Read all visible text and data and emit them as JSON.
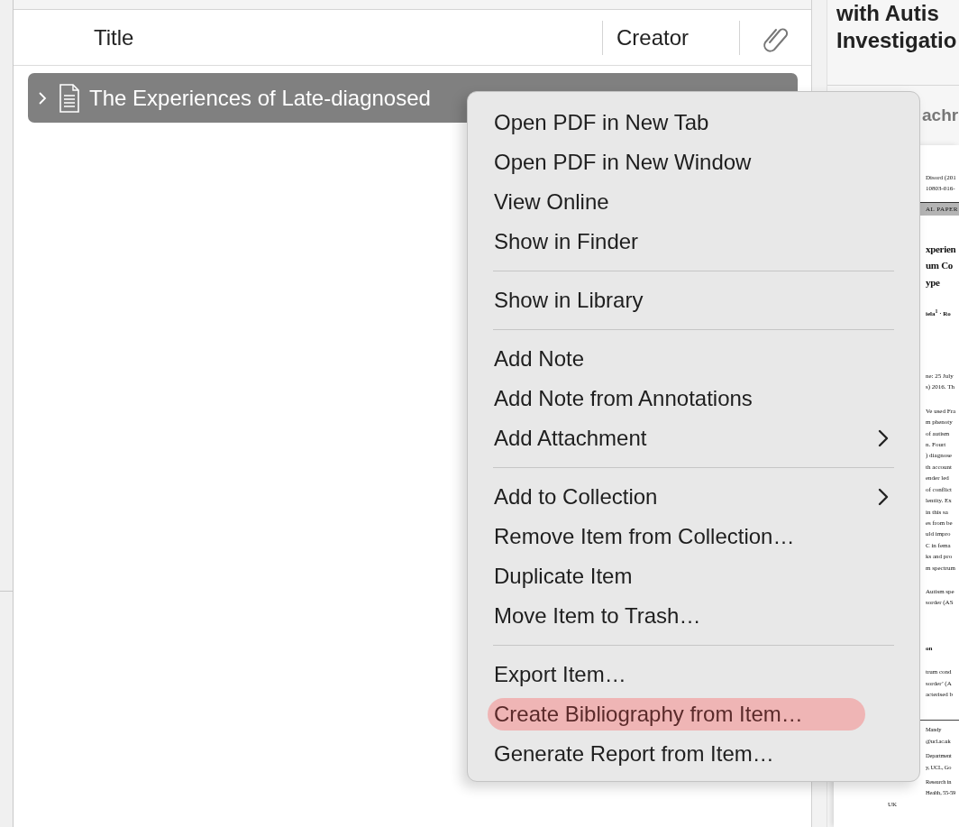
{
  "table": {
    "columns": [
      {
        "label": "Title",
        "kind": "text"
      },
      {
        "label": "Creator",
        "kind": "text"
      },
      {
        "kind": "attachment"
      }
    ],
    "rows": [
      {
        "title": "The Experiences of Late-diagnosed",
        "selected": true,
        "expanded": false
      }
    ]
  },
  "item_pane": {
    "title_lines": [
      "with Autis",
      "Investigatio"
    ],
    "section_header": "achr",
    "pdf_preview": {
      "blocks": [
        {
          "kind": "meta",
          "lines": [
            "Disord (201",
            "10803-016-"
          ]
        },
        {
          "kind": "band",
          "lines": [
            "AL PAPER"
          ]
        },
        {
          "kind": "title",
          "lines": [
            "xperien",
            "um Co",
            "ype"
          ]
        },
        {
          "kind": "author",
          "lines": [
            "iela$^{1}$ · Ro"
          ]
        },
        {
          "kind": "dates",
          "lines": [
            "ne: 25 July",
            "s) 2016. Th"
          ]
        },
        {
          "kind": "text",
          "lines": [
            "Ve used Fra",
            "m phenoty",
            "of autism",
            "n.  Fourt",
            ") diagnose",
            "th account",
            "ender led",
            "of conflict",
            "lentity. Ex",
            "in this sa",
            "es from be",
            "uld impro",
            "C in fema",
            "ks and pro",
            "m spectrum"
          ]
        },
        {
          "kind": "text",
          "lines": [
            "Autism spe",
            "sorder (AS"
          ]
        },
        {
          "kind": "heading",
          "lines": [
            "on"
          ]
        },
        {
          "kind": "text",
          "lines": [
            "trum cond",
            "sorder’ (A",
            "acterised b"
          ]
        },
        {
          "kind": "footnote",
          "lines": [
            "Mandy",
            "@ucl.ac.uk"
          ]
        },
        {
          "kind": "footnote",
          "lines": [
            "Department",
            "y, UCL, Go"
          ]
        },
        {
          "kind": "footnote",
          "lines": [
            "Research in",
            "Health, 55-59"
          ]
        },
        {
          "kind": "address",
          "lines": [
            "UK"
          ]
        }
      ]
    }
  },
  "context_menu": {
    "groups": [
      [
        {
          "label": "Open PDF in New Tab",
          "submenu": false,
          "selected": false
        },
        {
          "label": "Open PDF in New Window",
          "submenu": false,
          "selected": false
        },
        {
          "label": "View Online",
          "submenu": false,
          "selected": false
        },
        {
          "label": "Show in Finder",
          "submenu": false,
          "selected": false
        }
      ],
      [
        {
          "label": "Show in Library",
          "submenu": false,
          "selected": false
        }
      ],
      [
        {
          "label": "Add Note",
          "submenu": false,
          "selected": false
        },
        {
          "label": "Add Note from Annotations",
          "submenu": false,
          "selected": false
        },
        {
          "label": "Add Attachment",
          "submenu": true,
          "selected": false
        }
      ],
      [
        {
          "label": "Add to Collection",
          "submenu": true,
          "selected": false
        },
        {
          "label": "Remove Item from Collection…",
          "submenu": false,
          "selected": false
        },
        {
          "label": "Duplicate Item",
          "submenu": false,
          "selected": false
        },
        {
          "label": "Move Item to Trash…",
          "submenu": false,
          "selected": false
        }
      ],
      [
        {
          "label": "Export Item…",
          "submenu": false,
          "selected": false
        },
        {
          "label": "Create Bibliography from Item…",
          "submenu": false,
          "selected": true
        },
        {
          "label": "Generate Report from Item…",
          "submenu": false,
          "selected": false
        }
      ]
    ]
  }
}
